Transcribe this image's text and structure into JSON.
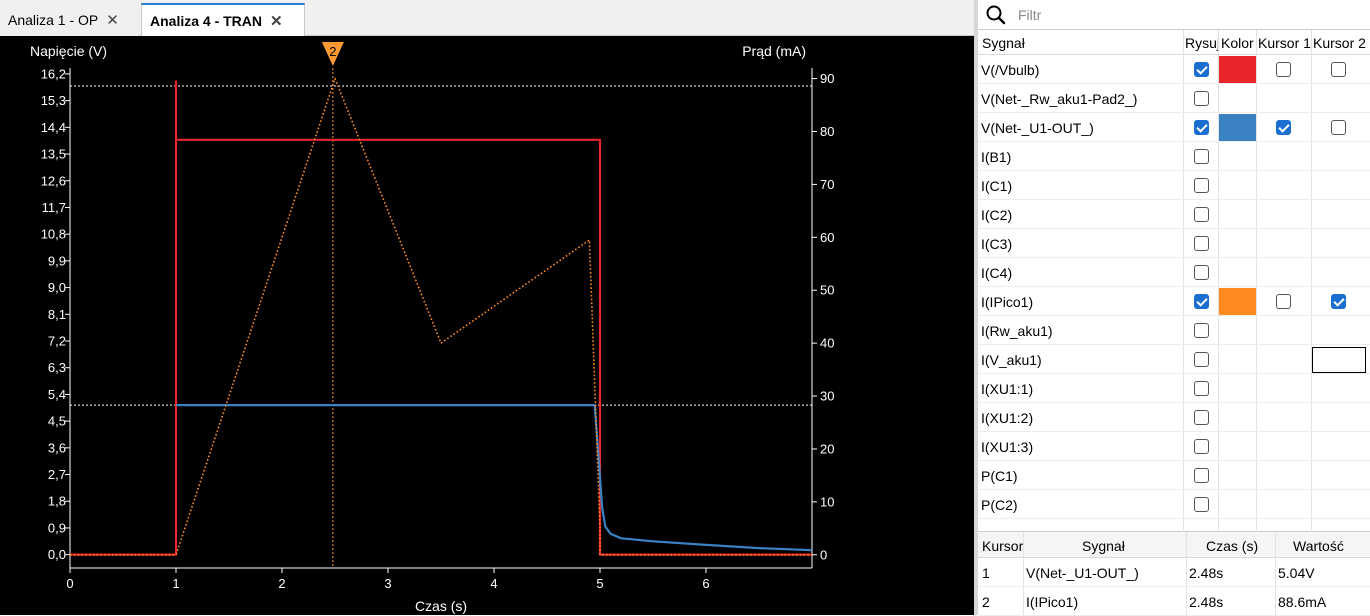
{
  "tabs": [
    {
      "label": "Analiza 1 - OP",
      "active": false
    },
    {
      "label": "Analiza 4 - TRAN",
      "active": true
    }
  ],
  "plot": {
    "left_axis_title": "Napięcie (V)",
    "right_axis_title": "Prąd (mA)",
    "x_axis_title": "Czas (s)",
    "cursor_marker_label": "2",
    "colors": {
      "background": "#000000",
      "vbulb": "#e8262b",
      "u1out": "#3b82c4",
      "ipico": "#ff8a1f",
      "cursor": "#ff9933"
    }
  },
  "chart_data": {
    "type": "line",
    "xlabel": "Czas (s)",
    "ylabel": "Napięcie (V)",
    "y2label": "Prąd (mA)",
    "xlim": [
      0,
      7
    ],
    "ylim": [
      -0.45,
      16.4
    ],
    "y2lim": [
      -2.5,
      92
    ],
    "x_ticks": [
      "0",
      "1",
      "2",
      "3",
      "4",
      "5",
      "6"
    ],
    "y_ticks": [
      "0,0",
      "0,9",
      "1,8",
      "2,7",
      "3,6",
      "4,5",
      "5,4",
      "6,3",
      "7,2",
      "8,1",
      "9,0",
      "9,9",
      "10,8",
      "11,7",
      "12,6",
      "13,5",
      "14,4",
      "15,3",
      "16,2"
    ],
    "y2_ticks": [
      "0",
      "10",
      "20",
      "30",
      "40",
      "50",
      "60",
      "70",
      "80",
      "90"
    ],
    "series": [
      {
        "name": "V(/Vbulb)",
        "axis": "left",
        "color": "#e8262b",
        "x": [
          0,
          1.0,
          1.0,
          1.0,
          1.01,
          5.0,
          5.0,
          7.0
        ],
        "y": [
          0,
          0,
          15.95,
          13.98,
          13.98,
          13.98,
          0,
          0
        ]
      },
      {
        "name": "V(Net-_U1-OUT_)",
        "axis": "left",
        "color": "#3b82c4",
        "x": [
          1.0,
          1.01,
          4.95,
          5.0,
          5.02,
          5.05,
          5.1,
          5.2,
          5.5,
          6.0,
          6.5,
          7.0
        ],
        "y": [
          5.04,
          5.04,
          5.04,
          2.6,
          1.6,
          0.95,
          0.7,
          0.55,
          0.45,
          0.33,
          0.22,
          0.15
        ]
      },
      {
        "name": "I(IPico1)",
        "axis": "right",
        "color": "#ff8a1f",
        "style": "dotted",
        "x": [
          0,
          1.0,
          2.5,
          3.5,
          4.9,
          5.0,
          5.0,
          7.0
        ],
        "y": [
          0,
          0,
          90,
          40,
          59.5,
          5,
          0,
          0
        ]
      }
    ],
    "reference_lines": [
      {
        "axis": "right",
        "value": 88.6
      },
      {
        "axis": "left",
        "value": 5.04
      }
    ],
    "cursor_x": 2.48,
    "legend": "none",
    "grid": false
  },
  "filter": {
    "placeholder": "Filtr",
    "value": ""
  },
  "signal_table": {
    "headers": {
      "signal": "Sygnał",
      "draw": "Rysuj",
      "color": "Kolor",
      "cursor1": "Kursor 1",
      "cursor2": "Kursor 2"
    },
    "rows": [
      {
        "name": "V(/Vbulb)",
        "draw": true,
        "color": "#e8262b",
        "cursor1": false,
        "cursor2": false
      },
      {
        "name": "V(Net-_Rw_aku1-Pad2_)",
        "draw": false
      },
      {
        "name": "V(Net-_U1-OUT_)",
        "draw": true,
        "color": "#3b82c4",
        "cursor1": true,
        "cursor2": false
      },
      {
        "name": "I(B1)",
        "draw": false
      },
      {
        "name": "I(C1)",
        "draw": false
      },
      {
        "name": "I(C2)",
        "draw": false
      },
      {
        "name": "I(C3)",
        "draw": false
      },
      {
        "name": "I(C4)",
        "draw": false
      },
      {
        "name": "I(IPico1)",
        "draw": true,
        "color": "#ff8a1f",
        "cursor1": false,
        "cursor2": true
      },
      {
        "name": "I(Rw_aku1)",
        "draw": false
      },
      {
        "name": "I(V_aku1)",
        "draw": false
      },
      {
        "name": "I(XU1:1)",
        "draw": false
      },
      {
        "name": "I(XU1:2)",
        "draw": false
      },
      {
        "name": "I(XU1:3)",
        "draw": false
      },
      {
        "name": "P(C1)",
        "draw": false
      },
      {
        "name": "P(C2)",
        "draw": false
      }
    ]
  },
  "cursor_table": {
    "headers": {
      "cursor": "Kursor",
      "signal": "Sygnał",
      "time": "Czas (s)",
      "value": "Wartość"
    },
    "rows": [
      {
        "cursor": "1",
        "signal": "V(Net-_U1-OUT_)",
        "time": "2.48s",
        "value": "5.04V"
      },
      {
        "cursor": "2",
        "signal": "I(IPico1)",
        "time": "2.48s",
        "value": "88.6mA"
      }
    ]
  }
}
